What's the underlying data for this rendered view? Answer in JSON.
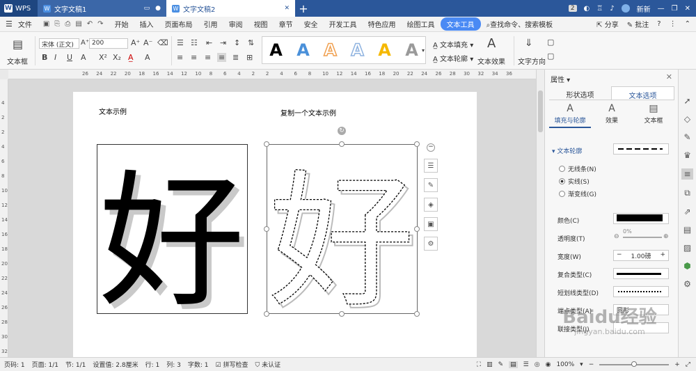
{
  "titlebar": {
    "app_name": "WPS",
    "tabs": [
      {
        "label": "文字文稿1"
      },
      {
        "label": "文字文稿2"
      }
    ],
    "badge": "2",
    "user": "新新"
  },
  "menu": {
    "file": "文件",
    "items": [
      "开始",
      "插入",
      "页面布局",
      "引用",
      "审阅",
      "视图",
      "章节",
      "安全",
      "开发工具",
      "特色应用",
      "绘图工具",
      "文本工具"
    ],
    "search": "查找命令、搜索模板",
    "share": "分享",
    "comment": "批注"
  },
  "ribbon": {
    "textbox_label": "文本框",
    "font_name": "宋体 (正文)",
    "font_size": "200",
    "text_fill": "文本填充",
    "text_outline": "文本轮廓",
    "text_effect": "文本效果",
    "text_direction": "文字方向",
    "gallery_glyph": "A",
    "gallery_colors": [
      "#000000",
      "#4a90d9",
      "#f0a050",
      "#8fb3e0",
      "#f5b800",
      "#9a9a9a"
    ]
  },
  "ruler": {
    "ticks": [
      "26",
      "24",
      "22",
      "20",
      "18",
      "16",
      "14",
      "12",
      "10",
      "8",
      "6",
      "4",
      "2",
      "2",
      "4",
      "6",
      "8",
      "10",
      "12",
      "14",
      "16",
      "18",
      "20",
      "22",
      "24",
      "26",
      "28",
      "30",
      "32",
      "34",
      "36"
    ],
    "vticks": [
      "4",
      "2",
      "2",
      "4",
      "6",
      "8",
      "10",
      "12",
      "14",
      "16",
      "18",
      "20",
      "22",
      "24",
      "26",
      "28",
      "30",
      "32"
    ]
  },
  "document": {
    "label_left": "文本示例",
    "label_right": "复制一个文本示例",
    "character": "好"
  },
  "panel": {
    "title": "属性",
    "tab_shape": "形状选项",
    "tab_text": "文本选项",
    "sub_fill": "填充与轮廓",
    "sub_effect": "效果",
    "sub_textbox": "文本框",
    "section_outline": "文本轮廓",
    "opt_none": "无线条(N)",
    "opt_solid": "实线(S)",
    "opt_gradient": "渐变线(G)",
    "color_label": "颜色(C)",
    "transparency_label": "透明度(T)",
    "transparency_value": "0%",
    "width_label": "宽度(W)",
    "width_value": "1.00磅",
    "compound_label": "复合类型(C)",
    "dash_label": "短划线类型(D)",
    "cap_label": "端点类型(A)",
    "cap_value": "圆形",
    "join_label": "联接类型(J)"
  },
  "status": {
    "page_num": "页码: 1",
    "pages": "页面: 1/1",
    "section": "节: 1/1",
    "position": "设置值: 2.8厘米",
    "row": "行: 1",
    "col": "列: 3",
    "words": "字数: 1",
    "spell": "拼写检查",
    "cert": "未认证",
    "zoom": "100%"
  },
  "watermark": {
    "brand": "Baidu经验",
    "url": "jingyan.baidu.com"
  }
}
